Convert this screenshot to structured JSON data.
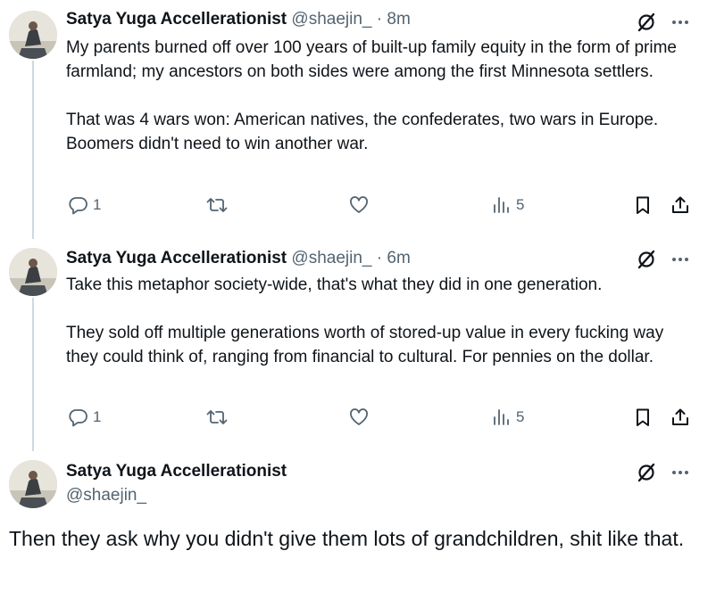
{
  "tweets": [
    {
      "author_name": "Satya Yuga Accellerationist",
      "handle": "@shaejin_",
      "separator": "·",
      "time": "8m",
      "paragraphs": [
        "My parents burned off over 100 years of built-up family equity in the form of prime farmland; my ancestors on both sides were among the first Minnesota settlers.",
        "That was 4 wars won: American natives, the confederates, two wars in Europe. Boomers didn't need to win another war."
      ],
      "replies": "1",
      "views": "5"
    },
    {
      "author_name": "Satya Yuga Accellerationist",
      "handle": "@shaejin_",
      "separator": "·",
      "time": "6m",
      "paragraphs": [
        "Take this metaphor society-wide, that's what they did in one generation.",
        "They sold off multiple generations worth of stored-up value in every fucking way they could think of, ranging from financial to cultural. For pennies on the dollar."
      ],
      "replies": "1",
      "views": "5"
    }
  ],
  "main_tweet": {
    "author_name": "Satya Yuga Accellerationist",
    "handle": "@shaejin_",
    "text": "Then they ask why you didn't give them lots of grandchildren, shit like that."
  },
  "icons": {
    "grok": "grok-icon",
    "more": "more-icon",
    "reply": "reply-icon",
    "retweet": "retweet-icon",
    "like": "like-icon",
    "views": "views-icon",
    "bookmark": "bookmark-icon",
    "share": "share-icon"
  },
  "colors": {
    "text_primary": "#0f1419",
    "text_secondary": "#536471",
    "thread_line": "#cfd9de"
  }
}
